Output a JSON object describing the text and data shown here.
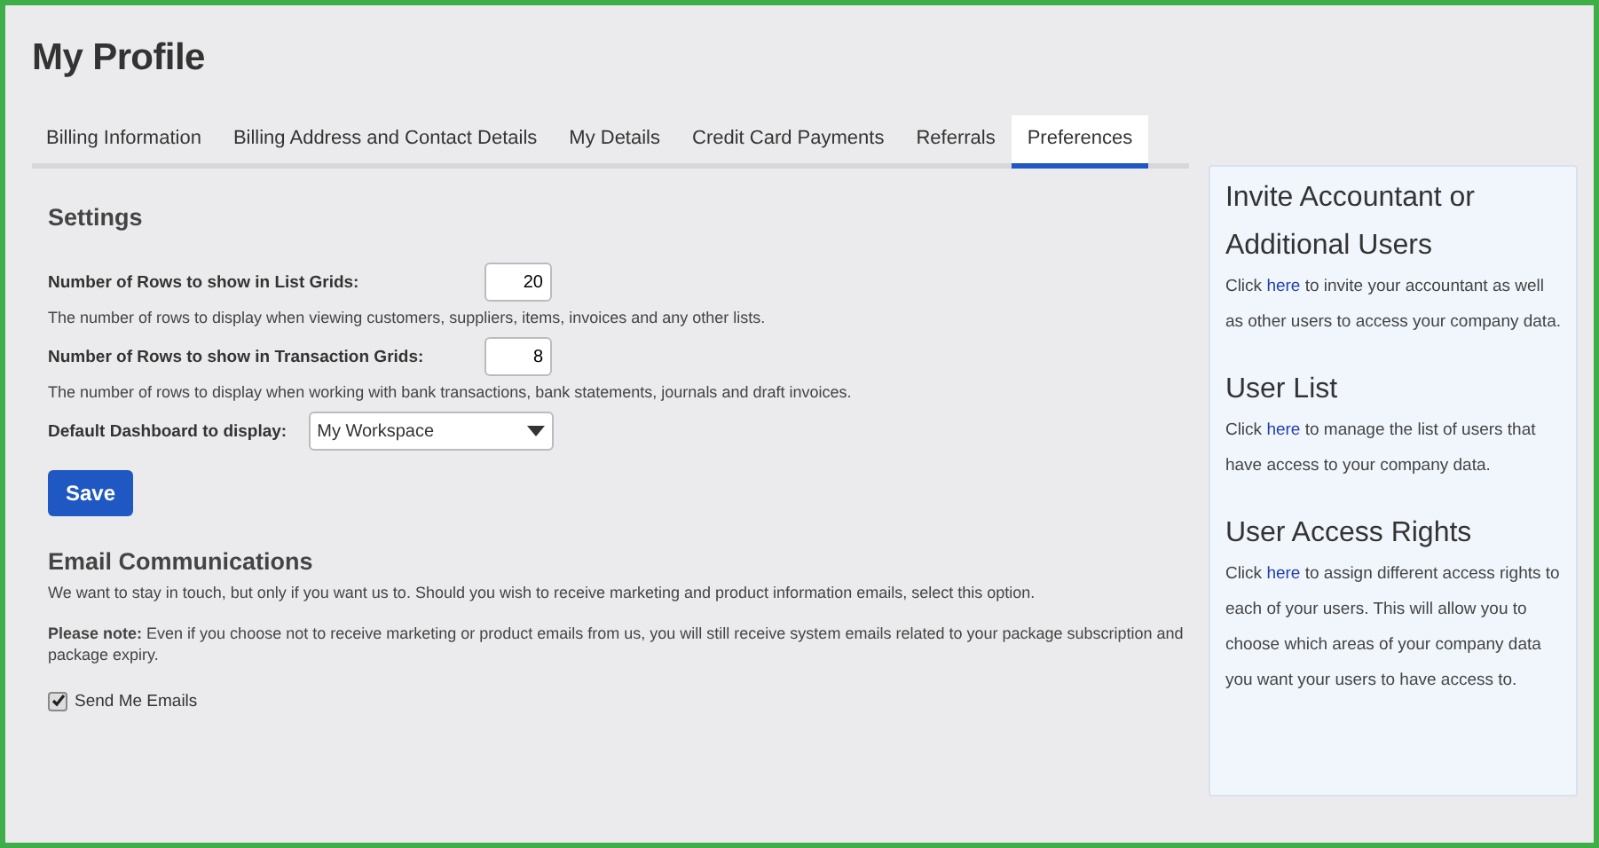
{
  "page_title": "My Profile",
  "tabs": [
    {
      "label": "Billing Information",
      "selected": false
    },
    {
      "label": "Billing Address and Contact Details",
      "selected": false
    },
    {
      "label": "My Details",
      "selected": false
    },
    {
      "label": "Credit Card Payments",
      "selected": false
    },
    {
      "label": "Referrals",
      "selected": false
    },
    {
      "label": "Preferences",
      "selected": true
    }
  ],
  "settings": {
    "heading": "Settings",
    "fields": [
      {
        "kind": "number",
        "label": "Number of Rows to show in List Grids:",
        "value": "20",
        "help": "The number of rows to display when viewing customers, suppliers, items, invoices and any other lists."
      },
      {
        "kind": "number",
        "label": "Number of Rows to show in Transaction Grids:",
        "value": "8",
        "help": "The number of rows to display when working with bank transactions, bank statements, journals and draft invoices."
      },
      {
        "kind": "select",
        "label": "Default Dashboard to display:",
        "value": "My Workspace"
      }
    ],
    "save_button": "Save"
  },
  "email": {
    "heading": "Email Communications",
    "intro": "We want to stay in touch, but only if you want us to. Should you wish to receive marketing and product information emails, select this option.",
    "note": "**Please note:** Even if you choose not to receive marketing or product emails from us, you will still receive system emails related to your package subscription and package expiry.",
    "checkbox": {
      "label": "Send Me Emails",
      "checked": true
    }
  },
  "sidebar": [
    {
      "title": "Invite Accountant or Additional Users",
      "before": "Click",
      "link": "here",
      "after": "to invite your accountant as well as other users to access your company data."
    },
    {
      "title": "User List",
      "before": "Click",
      "link": "here",
      "after": "to manage the list of users that have access to your company data."
    },
    {
      "title": "User Access Rights",
      "before": "Click",
      "link": "here",
      "after": "to assign different access rights to each of your users. This will allow you to choose which areas of your company data you want your users to have access to."
    }
  ]
}
